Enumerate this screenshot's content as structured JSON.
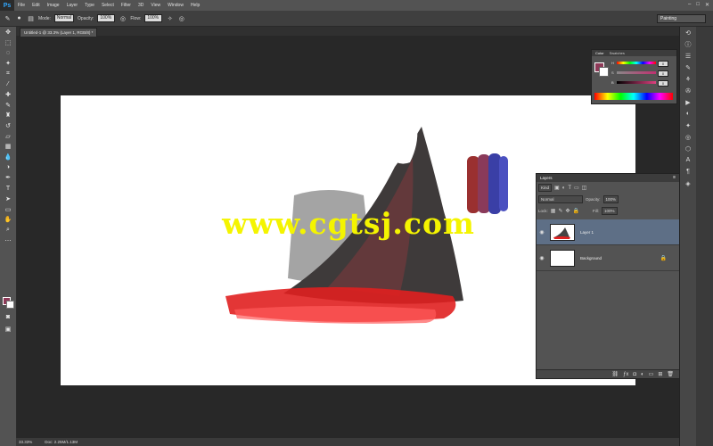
{
  "app": {
    "logo": "Ps"
  },
  "menu": [
    "File",
    "Edit",
    "Image",
    "Layer",
    "Type",
    "Select",
    "Filter",
    "3D",
    "View",
    "Window",
    "Help"
  ],
  "window_controls": [
    "–",
    "□",
    "✕"
  ],
  "options": {
    "mode_label": "Mode:",
    "mode_value": "Normal",
    "opacity_label": "Opacity:",
    "opacity_value": "100%",
    "flow_label": "Flow:",
    "flow_value": "100%",
    "workspace": "Painting"
  },
  "document": {
    "tab_label": "Untitled-1 @ 33.3% (Layer 1, RGB/8) *"
  },
  "watermark": "www.cgtsj.com",
  "status": {
    "zoom": "33.33%",
    "doc_size": "Doc: 2.25M/1.13M"
  },
  "swatches_panel": {
    "tabs": [
      "Color",
      "Swatches"
    ],
    "channels": [
      {
        "label": "H",
        "value": "0"
      },
      {
        "label": "S",
        "value": "0"
      },
      {
        "label": "B",
        "value": "0"
      }
    ]
  },
  "layers_panel": {
    "title": "Layers",
    "kind_filter": "Kind",
    "blend_mode": "Normal",
    "opacity_label": "Opacity:",
    "opacity_value": "100%",
    "lock_label": "Lock:",
    "fill_label": "Fill:",
    "fill_value": "100%",
    "layers": [
      {
        "name": "Layer 1",
        "selected": true,
        "locked": false
      },
      {
        "name": "Background",
        "selected": false,
        "locked": true
      }
    ]
  },
  "colors": {
    "foreground": "#8e3a58",
    "background": "#ffffff",
    "selection": "#5e6f86",
    "watermark": "#f4f400"
  }
}
